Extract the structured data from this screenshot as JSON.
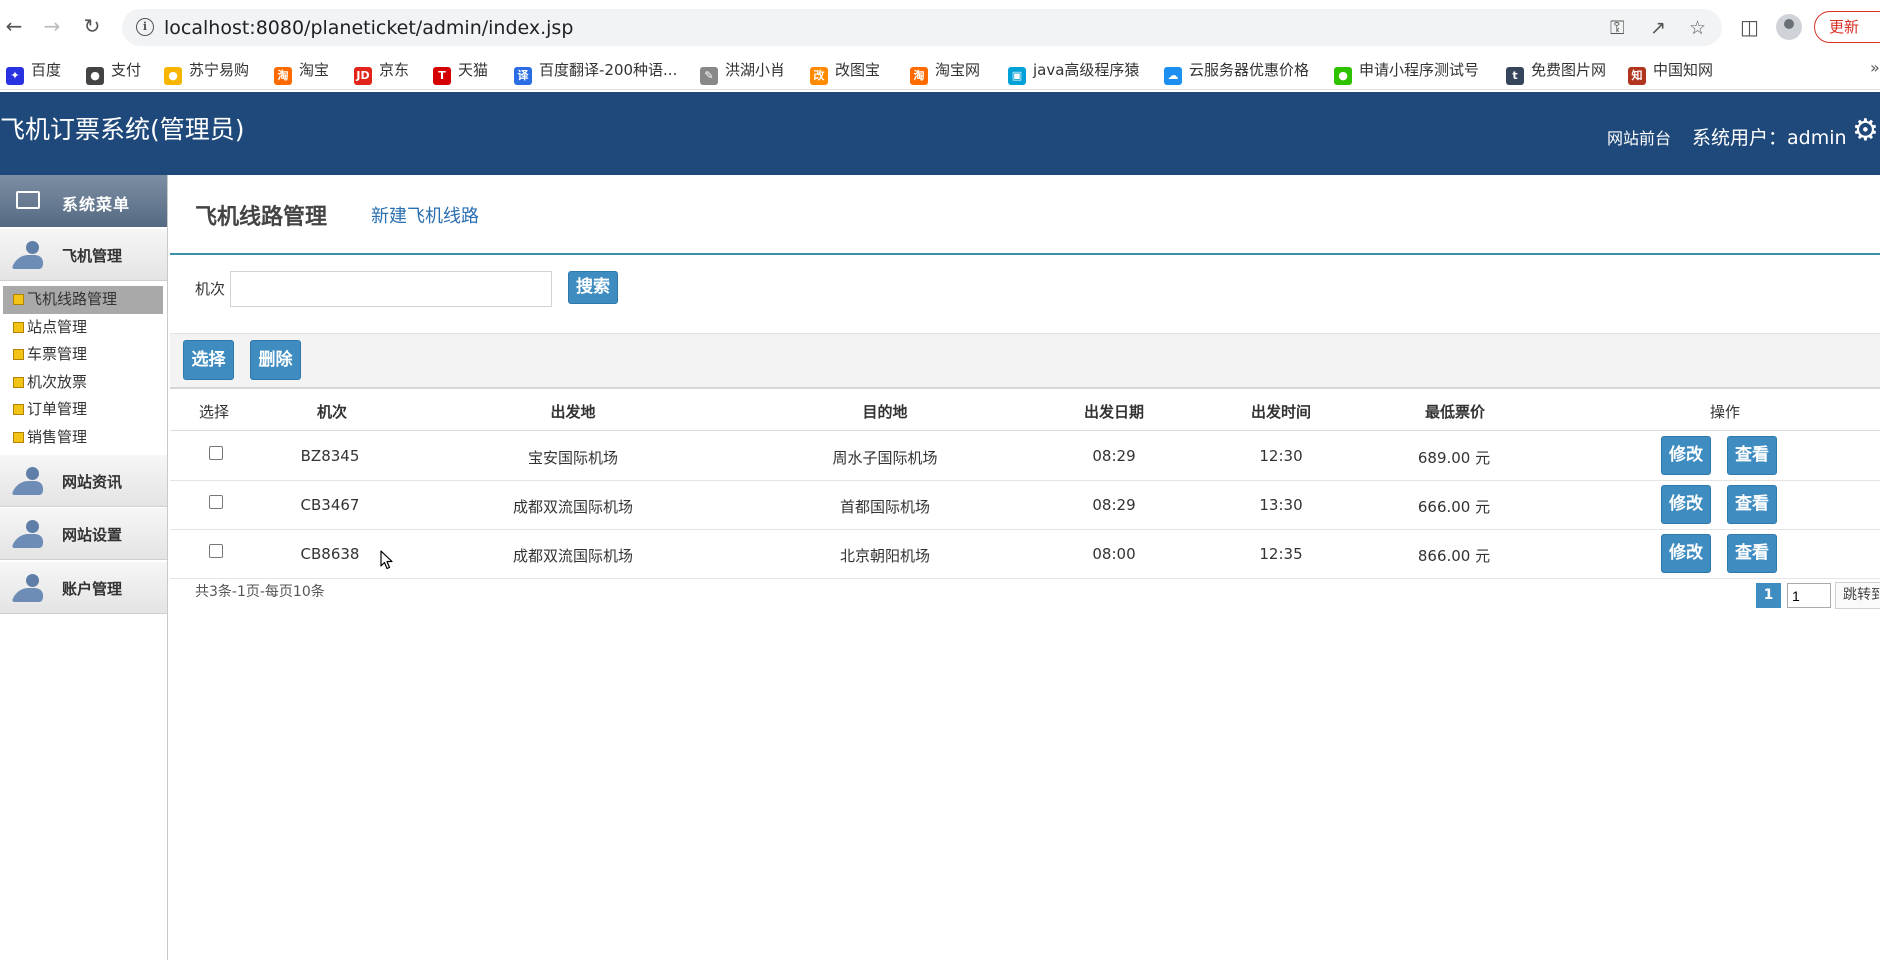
{
  "browser": {
    "url": "localhost:8080/planeticket/admin/index.jsp",
    "update_label": "更新",
    "bookmarks": [
      {
        "label": "百度",
        "icon": "baidu-icon",
        "color": "#2932e1"
      },
      {
        "label": "支付",
        "icon": "globe-icon",
        "color": "#444444"
      },
      {
        "label": "苏宁易购",
        "icon": "suning-icon",
        "color": "#f7b500"
      },
      {
        "label": "淘宝",
        "icon": "taobao-icon",
        "color": "#ff6a00"
      },
      {
        "label": "京东",
        "icon": "jd-icon",
        "color": "#e1251b"
      },
      {
        "label": "天猫",
        "icon": "tmall-icon",
        "color": "#d50000"
      },
      {
        "label": "百度翻译-200种语...",
        "icon": "translate-icon",
        "color": "#2b6de5"
      },
      {
        "label": "洪湖小肖",
        "icon": "fish-icon",
        "color": "#888888"
      },
      {
        "label": "改图宝",
        "icon": "gaitubao-icon",
        "color": "#ff8a00"
      },
      {
        "label": "淘宝网",
        "icon": "taobao-icon",
        "color": "#ff6a00"
      },
      {
        "label": "java高级程序猿",
        "icon": "bilibili-icon",
        "color": "#00a1d6"
      },
      {
        "label": "云服务器优惠价格",
        "icon": "cloud-icon",
        "color": "#1d8ff0"
      },
      {
        "label": "申请小程序测试号",
        "icon": "wechat-icon",
        "color": "#2dc100"
      },
      {
        "label": "免费图片网",
        "icon": "tumblr-icon",
        "color": "#35465c"
      },
      {
        "label": "中国知网",
        "icon": "cnki-icon",
        "color": "#b0341e"
      }
    ]
  },
  "header": {
    "title": "飞机订票系统(管理员)",
    "front_link": "网站前台",
    "user_label": "系统用户：admin"
  },
  "sidebar": {
    "menu_title": "系统菜单",
    "sections": [
      {
        "label": "飞机管理"
      },
      {
        "label": "网站资讯"
      },
      {
        "label": "网站设置"
      },
      {
        "label": "账户管理"
      }
    ],
    "sub_items": [
      {
        "label": "飞机线路管理",
        "active": true
      },
      {
        "label": "站点管理",
        "active": false
      },
      {
        "label": "车票管理",
        "active": false
      },
      {
        "label": "机次放票",
        "active": false
      },
      {
        "label": "订单管理",
        "active": false
      },
      {
        "label": "销售管理",
        "active": false
      }
    ]
  },
  "main": {
    "title": "飞机线路管理",
    "new_link": "新建飞机线路",
    "search_label": "机次",
    "search_value": "",
    "search_button": "搜索",
    "select_button": "选择",
    "delete_button": "删除",
    "columns": [
      "选择",
      "机次",
      "出发地",
      "目的地",
      "出发日期",
      "出发时间",
      "最低票价",
      "操作"
    ],
    "rows": [
      {
        "flight": "BZ8345",
        "from": "宝安国际机场",
        "to": "周水子国际机场",
        "date": "08:29",
        "time": "12:30",
        "price": "689.00 元"
      },
      {
        "flight": "CB3467",
        "from": "成都双流国际机场",
        "to": "首都国际机场",
        "date": "08:29",
        "time": "13:30",
        "price": "666.00 元"
      },
      {
        "flight": "CB8638",
        "from": "成都双流国际机场",
        "to": "北京朝阳机场",
        "date": "08:00",
        "time": "12:35",
        "price": "866.00 元"
      }
    ],
    "edit_label": "修改",
    "view_label": "查看",
    "summary": "共3条-1页-每页10条",
    "current_page": "1",
    "page_input": "1",
    "jump_label": "跳转到"
  }
}
